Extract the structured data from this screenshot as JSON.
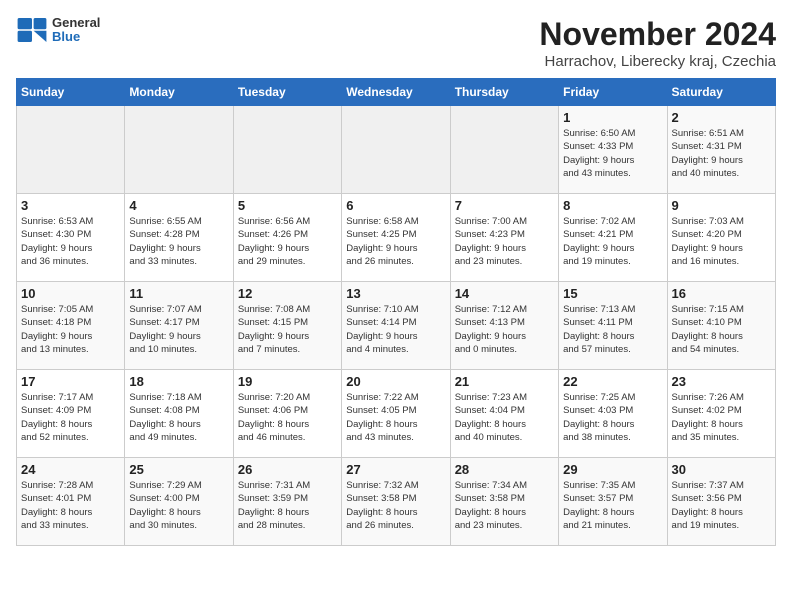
{
  "header": {
    "logo_general": "General",
    "logo_blue": "Blue",
    "month": "November 2024",
    "location": "Harrachov, Liberecky kraj, Czechia"
  },
  "days_of_week": [
    "Sunday",
    "Monday",
    "Tuesday",
    "Wednesday",
    "Thursday",
    "Friday",
    "Saturday"
  ],
  "weeks": [
    [
      {
        "day": "",
        "info": ""
      },
      {
        "day": "",
        "info": ""
      },
      {
        "day": "",
        "info": ""
      },
      {
        "day": "",
        "info": ""
      },
      {
        "day": "",
        "info": ""
      },
      {
        "day": "1",
        "info": "Sunrise: 6:50 AM\nSunset: 4:33 PM\nDaylight: 9 hours\nand 43 minutes."
      },
      {
        "day": "2",
        "info": "Sunrise: 6:51 AM\nSunset: 4:31 PM\nDaylight: 9 hours\nand 40 minutes."
      }
    ],
    [
      {
        "day": "3",
        "info": "Sunrise: 6:53 AM\nSunset: 4:30 PM\nDaylight: 9 hours\nand 36 minutes."
      },
      {
        "day": "4",
        "info": "Sunrise: 6:55 AM\nSunset: 4:28 PM\nDaylight: 9 hours\nand 33 minutes."
      },
      {
        "day": "5",
        "info": "Sunrise: 6:56 AM\nSunset: 4:26 PM\nDaylight: 9 hours\nand 29 minutes."
      },
      {
        "day": "6",
        "info": "Sunrise: 6:58 AM\nSunset: 4:25 PM\nDaylight: 9 hours\nand 26 minutes."
      },
      {
        "day": "7",
        "info": "Sunrise: 7:00 AM\nSunset: 4:23 PM\nDaylight: 9 hours\nand 23 minutes."
      },
      {
        "day": "8",
        "info": "Sunrise: 7:02 AM\nSunset: 4:21 PM\nDaylight: 9 hours\nand 19 minutes."
      },
      {
        "day": "9",
        "info": "Sunrise: 7:03 AM\nSunset: 4:20 PM\nDaylight: 9 hours\nand 16 minutes."
      }
    ],
    [
      {
        "day": "10",
        "info": "Sunrise: 7:05 AM\nSunset: 4:18 PM\nDaylight: 9 hours\nand 13 minutes."
      },
      {
        "day": "11",
        "info": "Sunrise: 7:07 AM\nSunset: 4:17 PM\nDaylight: 9 hours\nand 10 minutes."
      },
      {
        "day": "12",
        "info": "Sunrise: 7:08 AM\nSunset: 4:15 PM\nDaylight: 9 hours\nand 7 minutes."
      },
      {
        "day": "13",
        "info": "Sunrise: 7:10 AM\nSunset: 4:14 PM\nDaylight: 9 hours\nand 4 minutes."
      },
      {
        "day": "14",
        "info": "Sunrise: 7:12 AM\nSunset: 4:13 PM\nDaylight: 9 hours\nand 0 minutes."
      },
      {
        "day": "15",
        "info": "Sunrise: 7:13 AM\nSunset: 4:11 PM\nDaylight: 8 hours\nand 57 minutes."
      },
      {
        "day": "16",
        "info": "Sunrise: 7:15 AM\nSunset: 4:10 PM\nDaylight: 8 hours\nand 54 minutes."
      }
    ],
    [
      {
        "day": "17",
        "info": "Sunrise: 7:17 AM\nSunset: 4:09 PM\nDaylight: 8 hours\nand 52 minutes."
      },
      {
        "day": "18",
        "info": "Sunrise: 7:18 AM\nSunset: 4:08 PM\nDaylight: 8 hours\nand 49 minutes."
      },
      {
        "day": "19",
        "info": "Sunrise: 7:20 AM\nSunset: 4:06 PM\nDaylight: 8 hours\nand 46 minutes."
      },
      {
        "day": "20",
        "info": "Sunrise: 7:22 AM\nSunset: 4:05 PM\nDaylight: 8 hours\nand 43 minutes."
      },
      {
        "day": "21",
        "info": "Sunrise: 7:23 AM\nSunset: 4:04 PM\nDaylight: 8 hours\nand 40 minutes."
      },
      {
        "day": "22",
        "info": "Sunrise: 7:25 AM\nSunset: 4:03 PM\nDaylight: 8 hours\nand 38 minutes."
      },
      {
        "day": "23",
        "info": "Sunrise: 7:26 AM\nSunset: 4:02 PM\nDaylight: 8 hours\nand 35 minutes."
      }
    ],
    [
      {
        "day": "24",
        "info": "Sunrise: 7:28 AM\nSunset: 4:01 PM\nDaylight: 8 hours\nand 33 minutes."
      },
      {
        "day": "25",
        "info": "Sunrise: 7:29 AM\nSunset: 4:00 PM\nDaylight: 8 hours\nand 30 minutes."
      },
      {
        "day": "26",
        "info": "Sunrise: 7:31 AM\nSunset: 3:59 PM\nDaylight: 8 hours\nand 28 minutes."
      },
      {
        "day": "27",
        "info": "Sunrise: 7:32 AM\nSunset: 3:58 PM\nDaylight: 8 hours\nand 26 minutes."
      },
      {
        "day": "28",
        "info": "Sunrise: 7:34 AM\nSunset: 3:58 PM\nDaylight: 8 hours\nand 23 minutes."
      },
      {
        "day": "29",
        "info": "Sunrise: 7:35 AM\nSunset: 3:57 PM\nDaylight: 8 hours\nand 21 minutes."
      },
      {
        "day": "30",
        "info": "Sunrise: 7:37 AM\nSunset: 3:56 PM\nDaylight: 8 hours\nand 19 minutes."
      }
    ]
  ]
}
